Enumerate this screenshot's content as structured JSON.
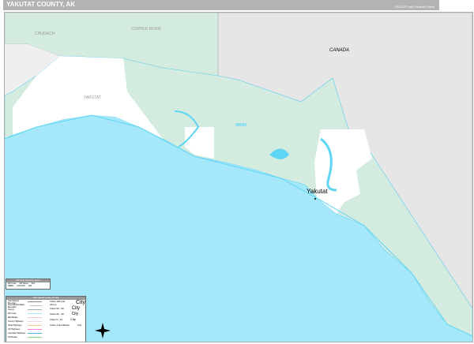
{
  "header": {
    "title": "YAKUTAT COUNTY, AK",
    "edition": "2020 ZIP Code Premium Edition",
    "logo_text": "Vector MAPS"
  },
  "map": {
    "colors": {
      "ocean": "#a5e7fb",
      "land": "#d4ebe0",
      "canada": "#e6e6e6",
      "unzoned": "#ffffff",
      "water": "#5fd5f5"
    },
    "labels": {
      "canada": "CANADA",
      "chugach": "CHUGACH",
      "copper_river": "COPPER RIVER",
      "yakutat_borough": "YAKUTAT",
      "zip": "99689",
      "city": "Yakutat"
    }
  },
  "zip_legend": {
    "title": "ZIP Code Selection Legend",
    "cols": [
      "ZIP Code",
      "ZIP Name",
      "Pop"
    ],
    "row": [
      "99689",
      "YAKUTAT",
      "662"
    ]
  },
  "legend": {
    "title": "2020 Yakutat County, AK Map",
    "items": [
      {
        "label": "International Boundary",
        "color": "#888888"
      },
      {
        "label": "International Water Boundary",
        "color": "#bbbbbb"
      },
      {
        "label": "County",
        "color": "#aaaaaa"
      },
      {
        "label": "ZIP Code",
        "color": "#a5e7fb"
      },
      {
        "label": "Rail Roads",
        "color": "#f2c9c9"
      },
      {
        "label": "County Highways",
        "color": "#e8d8e8"
      },
      {
        "label": "State Highways",
        "color": "#fcc98c"
      },
      {
        "label": "US Highways",
        "color": "#f57fc7"
      },
      {
        "label": "Interstate Highways",
        "color": "#4fb0e0"
      },
      {
        "label": "Toll Roads",
        "color": "#7fd67f"
      }
    ],
    "cities": [
      {
        "label": "Cities 100 and Above",
        "sample": "City"
      },
      {
        "label": "Cities 50 - 99",
        "sample": "City"
      },
      {
        "label": "Cities 25 - 49",
        "sample": "City"
      },
      {
        "label": "Cities 5 - 24",
        "sample": "City"
      },
      {
        "label": "Cities 4 and Below",
        "sample": "City"
      }
    ]
  }
}
